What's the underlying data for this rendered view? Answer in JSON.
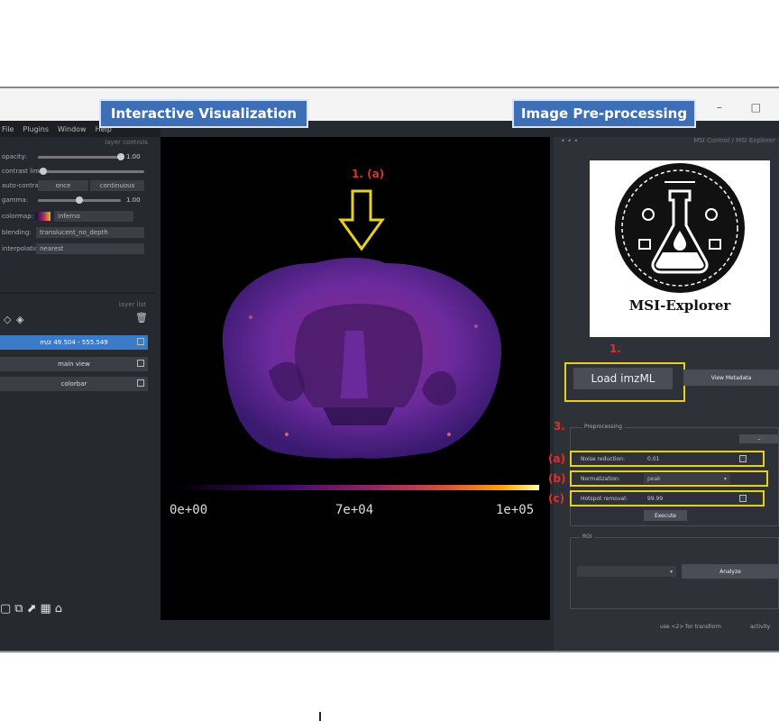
{
  "callouts": {
    "left": "Interactive Visualization",
    "right": "Image Pre-processing"
  },
  "window_controls": "– □",
  "menu": [
    "File",
    "Plugins",
    "Window",
    "Help"
  ],
  "layer_controls": {
    "header": "layer controls",
    "rows": [
      {
        "label": "opacity:",
        "value": "1.00"
      },
      {
        "label": "contrast limits:",
        "value": ""
      },
      {
        "label": "auto-contrast:",
        "value": ""
      },
      {
        "label": "gamma:",
        "value": "1.00"
      },
      {
        "label": "colormap:",
        "value": "inferno"
      },
      {
        "label": "blending:",
        "value": "translucent_no_depth"
      },
      {
        "label": "interpolation:",
        "value": "nearest"
      }
    ],
    "autocontrast_once": "once",
    "autocontrast_continuous": "continuous",
    "slider_levels": [
      1.0,
      0.05,
      0.5
    ]
  },
  "layer_list": {
    "header": "layer list",
    "layers": [
      {
        "name": "m/z 49.504 - 555.549",
        "active": true
      },
      {
        "name": "main view",
        "active": false
      },
      {
        "name": "colorbar",
        "active": false
      }
    ]
  },
  "canvas": {
    "annotation": "1. (a)",
    "colorbar_ticks": [
      "0e+00",
      "7e+04",
      "1e+05"
    ]
  },
  "right_panel": {
    "title": "MSI Control / MSI Explorer",
    "logo_text": "MSI-Explorer",
    "step1_label": "1.",
    "load_button": "Load imzML",
    "view_metadata": "View Metadata",
    "step3_label": "3.",
    "preprocessing_group": "Preprocessing",
    "params": [
      {
        "marker": "(a)",
        "label": "Noise reduction:",
        "value": "0.01",
        "checked": true
      },
      {
        "marker": "(b)",
        "label": "Normalization:",
        "value": "peak",
        "dropdown": true
      },
      {
        "marker": "(c)",
        "label": "Hotspot removal:",
        "value": "99.99",
        "checked": true
      }
    ],
    "execute_button": "Execute",
    "roi_group": "ROI",
    "analyze_button": "Analyze"
  },
  "statusbar": {
    "left": "use <2> for transform",
    "right": "activity"
  },
  "colors": {
    "callout_bg": "#3d6fb6",
    "highlight": "#e8d020",
    "annotation": "#e03028",
    "active_layer": "#3a7ac6"
  }
}
